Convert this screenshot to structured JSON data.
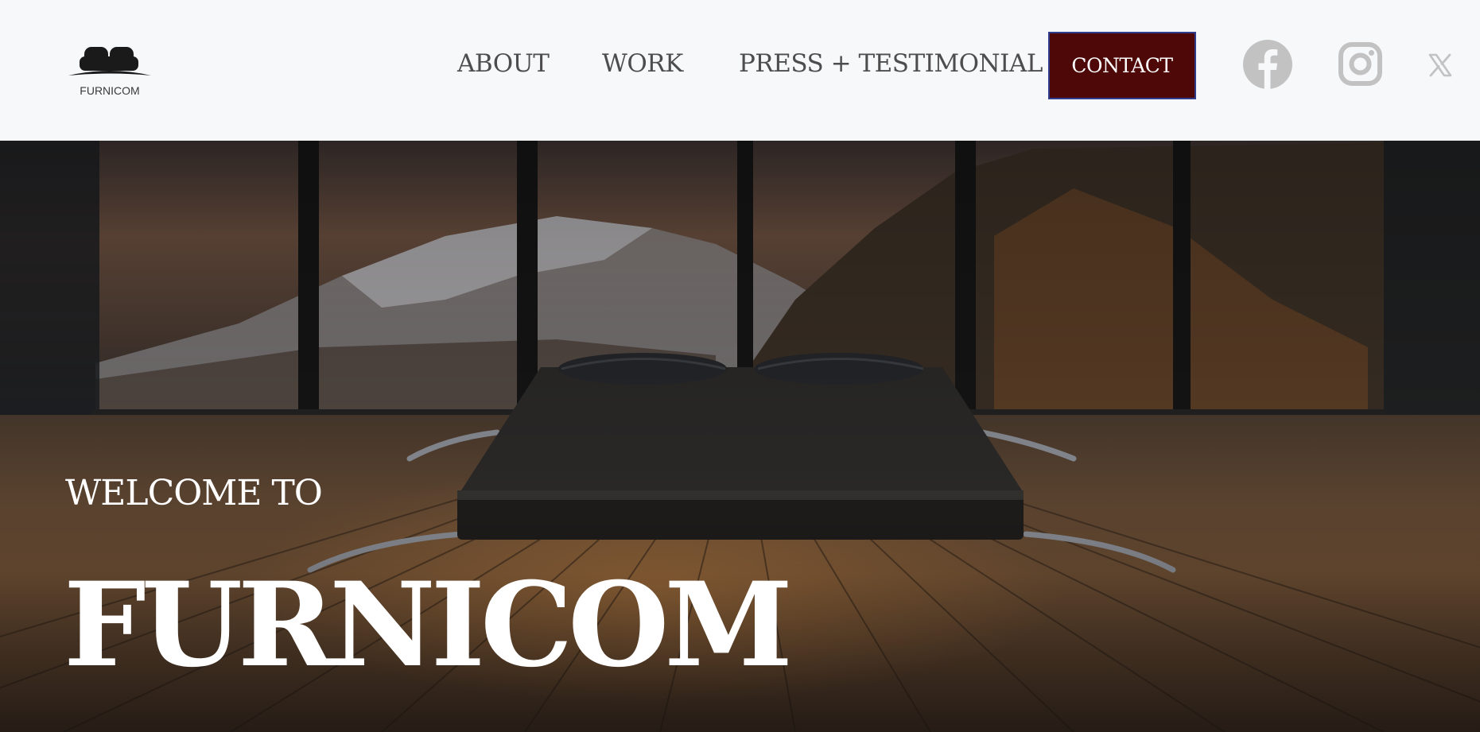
{
  "header": {
    "logo_text": "FURNICOM",
    "nav": [
      {
        "label": "ABOUT"
      },
      {
        "label": "WORK"
      },
      {
        "label": "PRESS + TESTIMONIAL"
      }
    ],
    "contact_label": "CONTACT",
    "social": [
      "facebook-icon",
      "instagram-icon",
      "x-icon"
    ]
  },
  "hero": {
    "welcome": "WELCOME TO",
    "title": "FURNICOM"
  },
  "colors": {
    "header_bg": "#f7f8fa",
    "nav_text": "#4d4d4d",
    "contact_bg": "#4e0808",
    "contact_border": "#2f3d8c",
    "social_icon": "#c2c2c2",
    "hero_text": "#ffffff"
  }
}
